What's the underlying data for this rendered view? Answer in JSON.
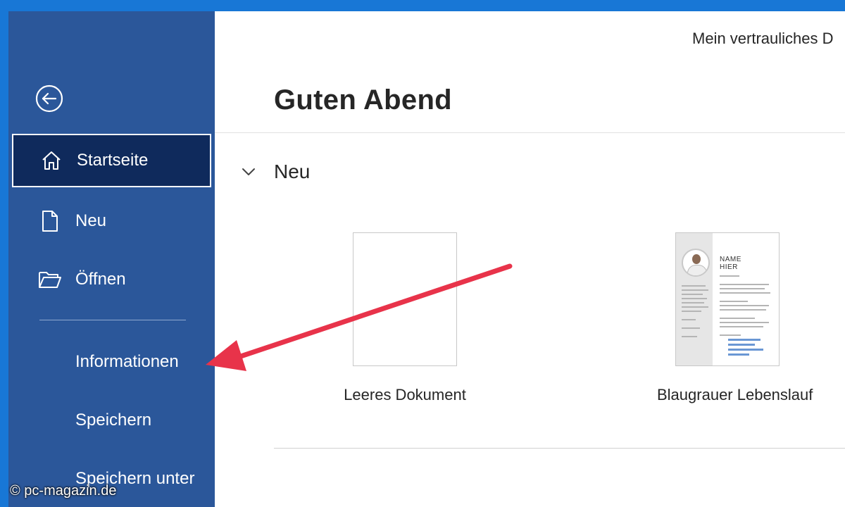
{
  "window": {
    "document_name": "Mein vertrauliches D"
  },
  "sidebar": {
    "back_icon": "back-arrow-circle-icon",
    "items": [
      {
        "label": "Startseite",
        "icon": "home-icon",
        "active": true
      },
      {
        "label": "Neu",
        "icon": "new-document-icon"
      },
      {
        "label": "Öffnen",
        "icon": "folder-open-icon"
      },
      {
        "label": "Informationen"
      },
      {
        "label": "Speichern"
      },
      {
        "label": "Speichern unter"
      }
    ]
  },
  "main": {
    "greeting": "Guten Abend",
    "section": {
      "label": "Neu",
      "icon": "chevron-down-icon"
    },
    "templates": [
      {
        "caption": "Leeres Dokument"
      },
      {
        "caption": "Blaugrauer Lebenslauf",
        "thumb_name": "NAME",
        "thumb_name2": "HIER"
      }
    ]
  },
  "annotation": {
    "color": "#e8334a"
  },
  "watermark": "© pc-magazin.de",
  "colors": {
    "sidebar_bg": "#2b579a",
    "active_bg": "#0f2a5c",
    "accent_blue": "#1877d6"
  }
}
